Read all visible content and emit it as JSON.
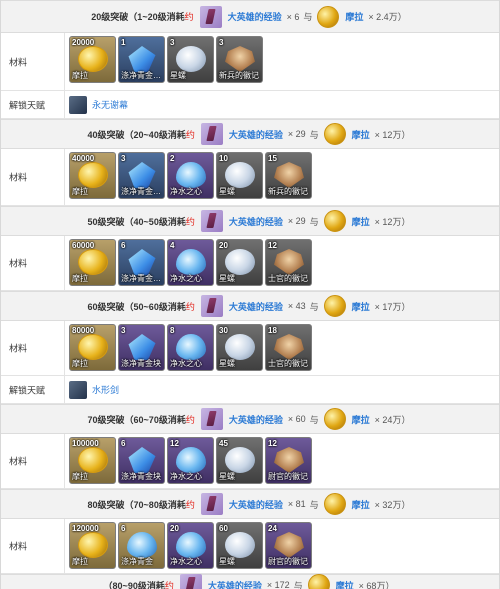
{
  "headers": [
    {
      "prefix": "20级突破（1~20级消耗",
      "red": "约",
      "exp": "大英雄的经验",
      "exp_count": "× 6",
      "conj": "与",
      "mora": "摩拉",
      "mora_count": "× 2.4万）"
    },
    {
      "prefix": "40级突破（20~40级消耗",
      "red": "约",
      "exp": "大英雄的经验",
      "exp_count": "× 29",
      "conj": "与",
      "mora": "摩拉",
      "mora_count": "× 12万）"
    },
    {
      "prefix": "50级突破（40~50级消耗",
      "red": "约",
      "exp": "大英雄的经验",
      "exp_count": "× 29",
      "conj": "与",
      "mora": "摩拉",
      "mora_count": "× 12万）"
    },
    {
      "prefix": "60级突破（50~60级消耗",
      "red": "约",
      "exp": "大英雄的经验",
      "exp_count": "× 43",
      "conj": "与",
      "mora": "摩拉",
      "mora_count": "× 17万）"
    },
    {
      "prefix": "70级突破（60~70级消耗",
      "red": "约",
      "exp": "大英雄的经验",
      "exp_count": "× 60",
      "conj": "与",
      "mora": "摩拉",
      "mora_count": "× 24万）"
    },
    {
      "prefix": "80级突破（70~80级消耗",
      "red": "约",
      "exp": "大英雄的经验",
      "exp_count": "× 81",
      "conj": "与",
      "mora": "摩拉",
      "mora_count": "× 32万）"
    },
    {
      "prefix": "（80~90级消耗",
      "red": "约",
      "exp": "大英雄的经验",
      "exp_count": "× 172",
      "conj": "与",
      "mora": "摩拉",
      "mora_count": "× 68万）"
    }
  ],
  "material_label": "材料",
  "talent_label": "解锁天赋",
  "talents": [
    "永无谢幕",
    "水形剑"
  ],
  "material_rows": [
    [
      {
        "qty": "20000",
        "name": "摩拉",
        "art": "coin",
        "rarity": "gold"
      },
      {
        "qty": "1",
        "name": "涤净青金…",
        "art": "crystal",
        "rarity": "blue"
      },
      {
        "qty": "3",
        "name": "星螺",
        "art": "shell",
        "rarity": "gray"
      },
      {
        "qty": "3",
        "name": "新兵的徽记",
        "art": "badge",
        "rarity": "gray"
      }
    ],
    [
      {
        "qty": "40000",
        "name": "摩拉",
        "art": "coin",
        "rarity": "gold"
      },
      {
        "qty": "3",
        "name": "涤净青金…",
        "art": "crystal",
        "rarity": "blue"
      },
      {
        "qty": "2",
        "name": "净水之心",
        "art": "drop",
        "rarity": "purple"
      },
      {
        "qty": "10",
        "name": "星螺",
        "art": "shell",
        "rarity": "gray"
      },
      {
        "qty": "15",
        "name": "新兵的徽记",
        "art": "badge",
        "rarity": "gray"
      }
    ],
    [
      {
        "qty": "60000",
        "name": "摩拉",
        "art": "coin",
        "rarity": "gold"
      },
      {
        "qty": "6",
        "name": "涤净青金…",
        "art": "crystal",
        "rarity": "blue"
      },
      {
        "qty": "4",
        "name": "净水之心",
        "art": "drop",
        "rarity": "purple"
      },
      {
        "qty": "20",
        "name": "星螺",
        "art": "shell",
        "rarity": "gray"
      },
      {
        "qty": "12",
        "name": "士官的徽记",
        "art": "badge",
        "rarity": "gray"
      }
    ],
    [
      {
        "qty": "80000",
        "name": "摩拉",
        "art": "coin",
        "rarity": "gold"
      },
      {
        "qty": "3",
        "name": "涤净青金块",
        "art": "crystal",
        "rarity": "purple"
      },
      {
        "qty": "8",
        "name": "净水之心",
        "art": "drop",
        "rarity": "purple"
      },
      {
        "qty": "30",
        "name": "星螺",
        "art": "shell",
        "rarity": "gray"
      },
      {
        "qty": "18",
        "name": "士官的徽记",
        "art": "badge",
        "rarity": "gray"
      }
    ],
    [
      {
        "qty": "100000",
        "name": "摩拉",
        "art": "coin",
        "rarity": "gold"
      },
      {
        "qty": "6",
        "name": "涤净青金块",
        "art": "crystal",
        "rarity": "purple"
      },
      {
        "qty": "12",
        "name": "净水之心",
        "art": "drop",
        "rarity": "purple"
      },
      {
        "qty": "45",
        "name": "星螺",
        "art": "shell",
        "rarity": "gray"
      },
      {
        "qty": "12",
        "name": "尉官的徽记",
        "art": "badge",
        "rarity": "purple"
      }
    ],
    [
      {
        "qty": "120000",
        "name": "摩拉",
        "art": "coin",
        "rarity": "gold"
      },
      {
        "qty": "6",
        "name": "涤净青金",
        "art": "drop",
        "rarity": "gold"
      },
      {
        "qty": "20",
        "name": "净水之心",
        "art": "drop",
        "rarity": "purple"
      },
      {
        "qty": "60",
        "name": "星螺",
        "art": "shell",
        "rarity": "gray"
      },
      {
        "qty": "24",
        "name": "尉官的徽记",
        "art": "badge",
        "rarity": "purple"
      }
    ]
  ]
}
